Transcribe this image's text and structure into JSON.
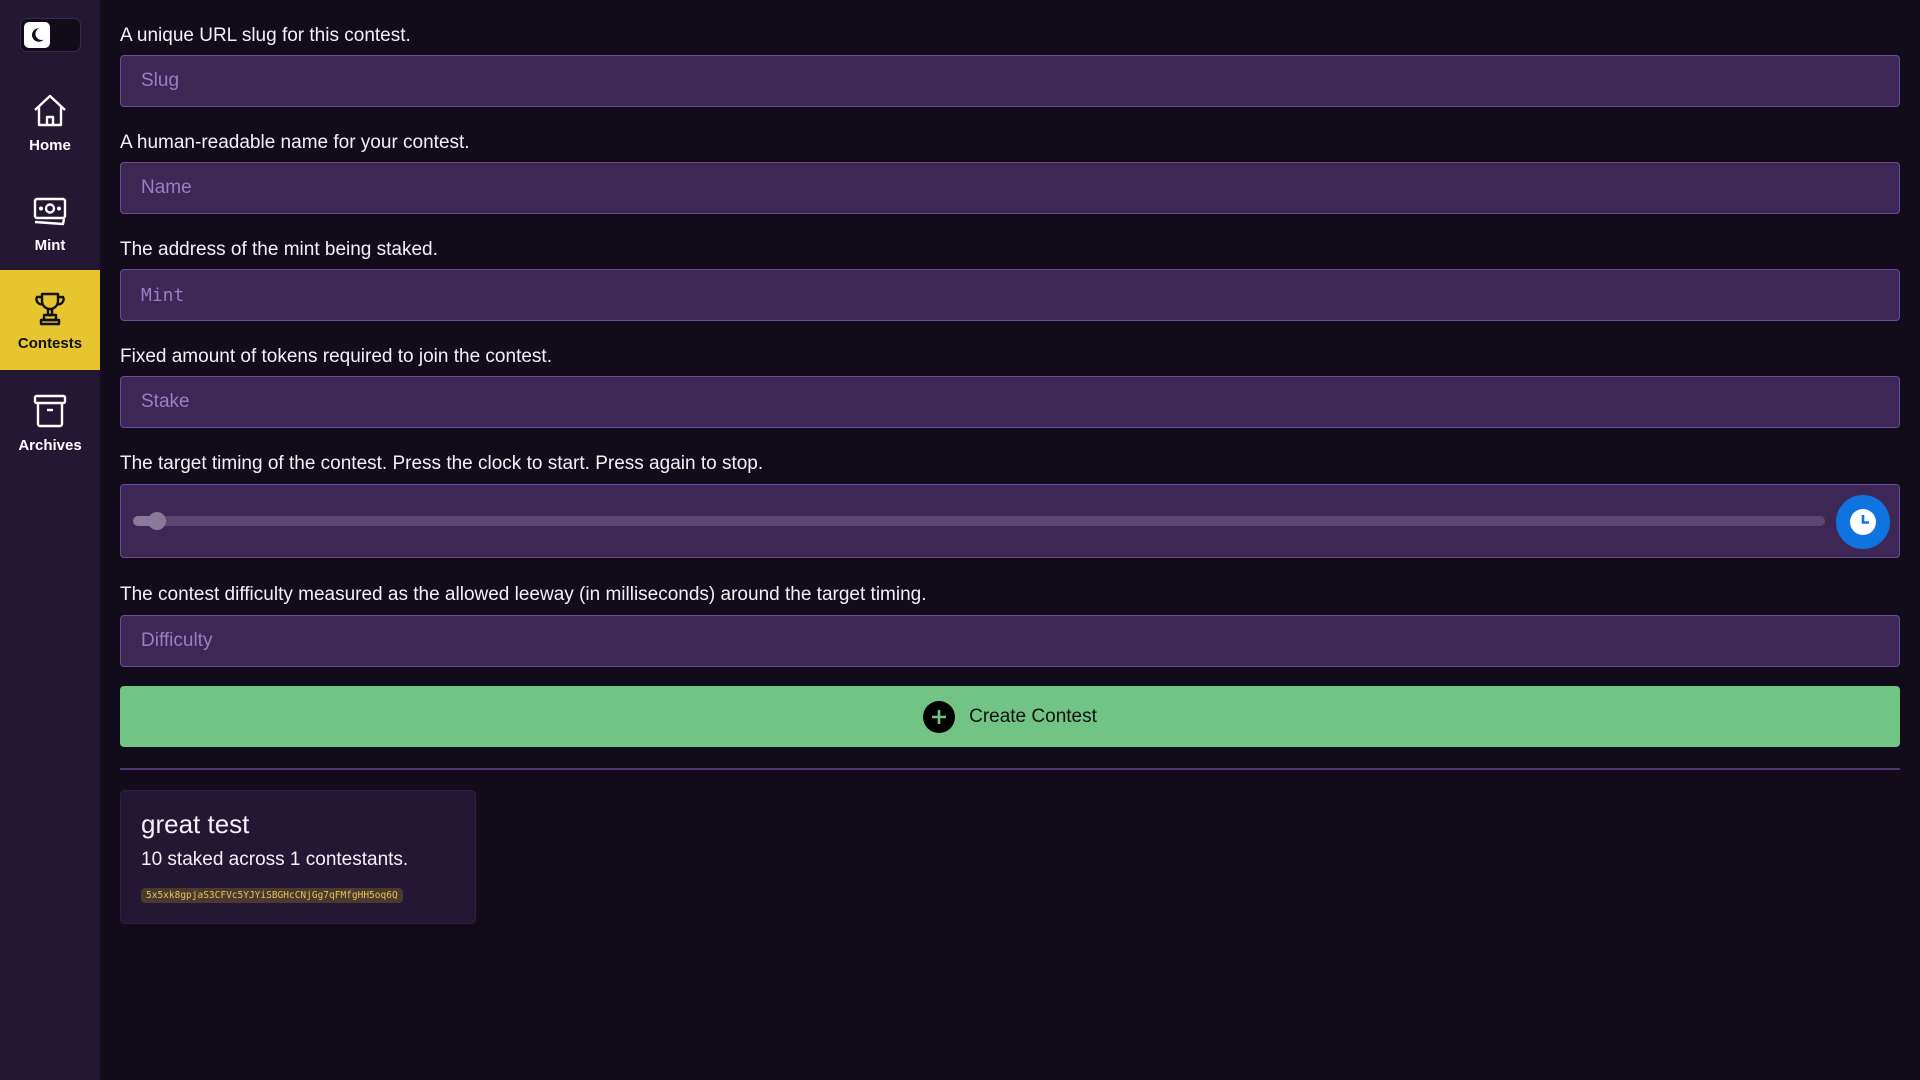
{
  "sidebar": {
    "theme_toggle": {
      "mode": "dark",
      "icon": "moon-icon"
    },
    "items": [
      {
        "label": "Home",
        "icon": "home-icon",
        "active": false
      },
      {
        "label": "Mint",
        "icon": "banknote-icon",
        "active": false
      },
      {
        "label": "Contests",
        "icon": "trophy-icon",
        "active": true
      },
      {
        "label": "Archives",
        "icon": "archive-box-icon",
        "active": false
      }
    ]
  },
  "form": {
    "slug": {
      "label": "A unique URL slug for this contest.",
      "placeholder": "Slug",
      "value": ""
    },
    "name": {
      "label": "A human-readable name for your contest.",
      "placeholder": "Name",
      "value": ""
    },
    "mint": {
      "label": "The address of the mint being staked.",
      "placeholder": "Mint",
      "value": ""
    },
    "stake": {
      "label": "Fixed amount of tokens required to join the contest.",
      "placeholder": "Stake",
      "value": ""
    },
    "timing": {
      "label": "The target timing of the contest. Press the clock to start. Press again to stop.",
      "slider_fraction": 0.012,
      "button_icon": "clock-icon"
    },
    "difficulty": {
      "label": "The contest difficulty measured as the allowed leeway (in milliseconds) around the target timing.",
      "placeholder": "Difficulty",
      "value": ""
    },
    "submit_label": "Create Contest",
    "submit_icon": "plus-circle-icon"
  },
  "colors": {
    "accent_yellow": "#e6c52f",
    "create_green": "#71c483",
    "clock_blue": "#0f74e0",
    "input_bg": "#3d2755",
    "page_bg": "#120c1a"
  },
  "contests": [
    {
      "title": "great test",
      "summary": "10 staked across 1 contestants.",
      "address": "5x5xk8gpjaS3CFVc5YJYiSBGHcCNjGg7qFMfgHH5oq6Q"
    }
  ]
}
